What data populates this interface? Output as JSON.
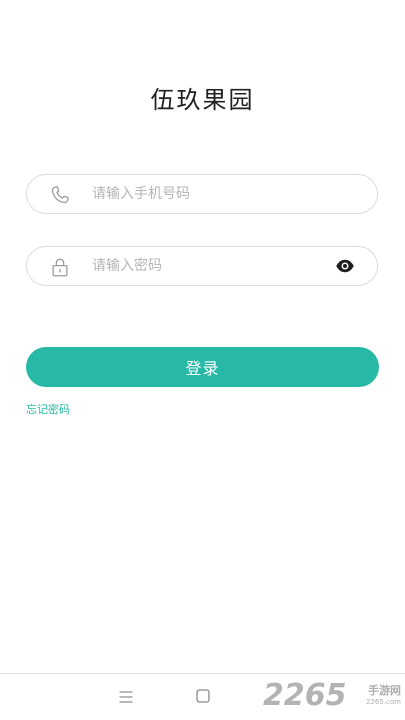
{
  "app": {
    "title": "伍玖果园"
  },
  "form": {
    "phone_placeholder": "请输入手机号码",
    "password_placeholder": "请输入密码",
    "login_label": "登录",
    "forgot_label": "忘记密码"
  },
  "icons": {
    "phone": "phone-icon",
    "lock": "lock-icon",
    "eye": "eye-icon",
    "menu": "menu-icon",
    "home": "home-icon"
  },
  "colors": {
    "accent": "#27b9a5",
    "placeholder": "#b5b5b5",
    "border": "#dcdcdc"
  },
  "watermark": {
    "number": "2265",
    "site": "手游网",
    "url": "2265.com"
  }
}
